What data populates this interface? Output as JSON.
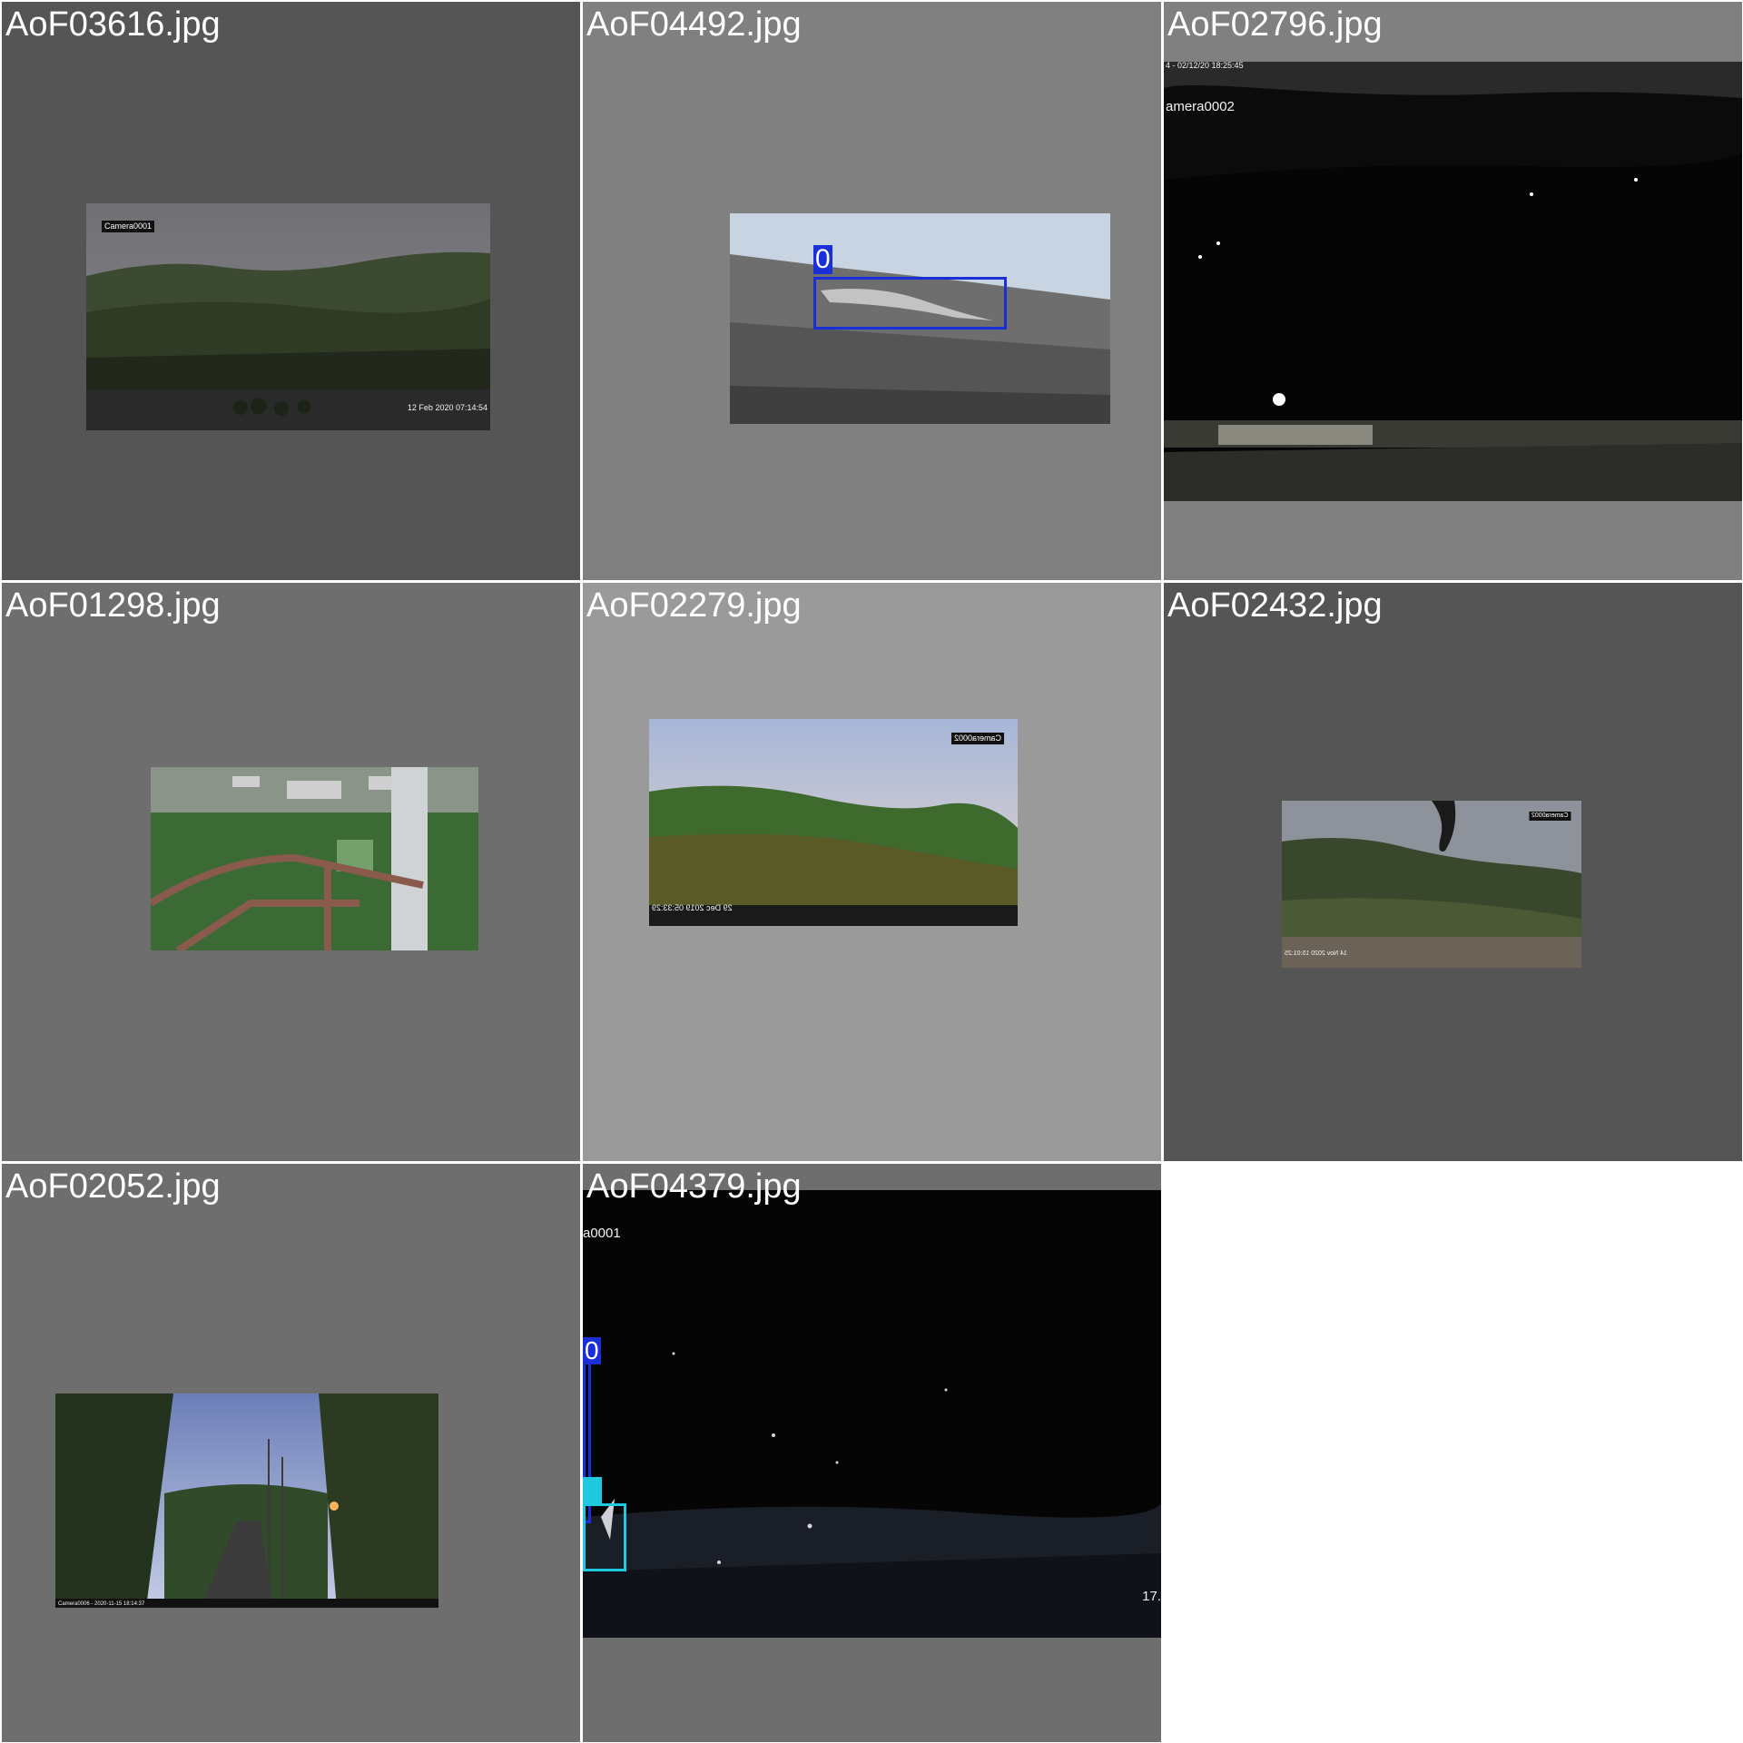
{
  "tiles": [
    {
      "filename": "AoF03616.jpg",
      "background": "#555555",
      "overlays": {
        "camera": "Camera0001",
        "timestamp": "12 Feb 2020  07:14:54"
      },
      "detections": []
    },
    {
      "filename": "AoF04492.jpg",
      "background": "#808080",
      "overlays": {},
      "detections": [
        {
          "label": "0",
          "color": "#1a2fd8"
        }
      ]
    },
    {
      "filename": "AoF02796.jpg",
      "background": "#808080",
      "overlays": {
        "camera": "amera0002",
        "timestamp": "4 - 02/12/20  18:25:45"
      },
      "detections": []
    },
    {
      "filename": "AoF01298.jpg",
      "background": "#6e6e6e",
      "overlays": {},
      "detections": []
    },
    {
      "filename": "AoF02279.jpg",
      "background": "#9a9a9a",
      "overlays": {
        "camera": "Camera0002",
        "timestamp": "29 Dec 2019  05:33:29"
      },
      "detections": []
    },
    {
      "filename": "AoF02432.jpg",
      "background": "#555555",
      "overlays": {
        "camera": "Camera0002",
        "timestamp": "14 Nov 2020  15:01:25"
      },
      "detections": []
    },
    {
      "filename": "AoF02052.jpg",
      "background": "#6e6e6e",
      "overlays": {
        "camera": "Camera0006 - 2020-11-15  18:14:37"
      },
      "detections": []
    },
    {
      "filename": "AoF04379.jpg",
      "background": "#6e6e6e",
      "overlays": {
        "camera": "a0001",
        "timestamp": "17."
      },
      "detections": [
        {
          "label": "0",
          "color": "#1a2fd8"
        },
        {
          "label": "",
          "color": "#20c8e0"
        }
      ]
    }
  ]
}
